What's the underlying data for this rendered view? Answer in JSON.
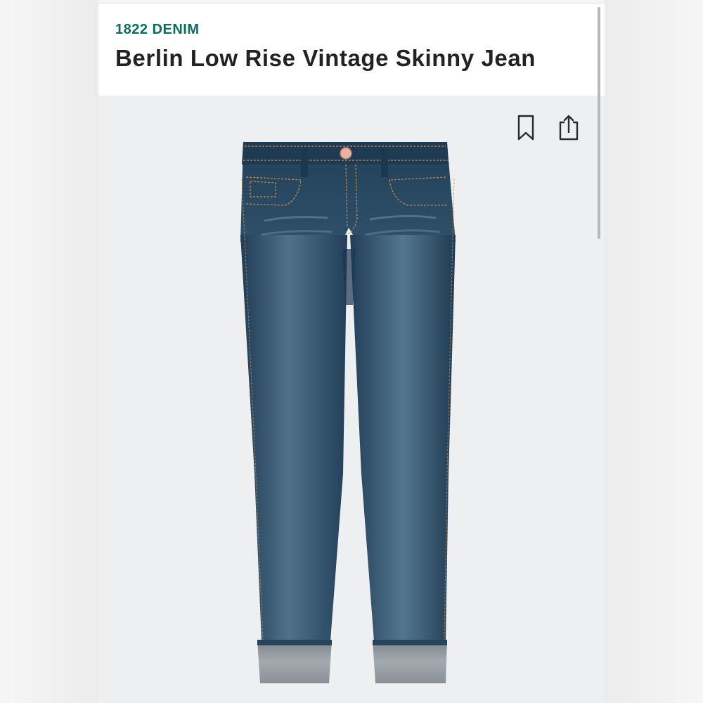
{
  "product": {
    "brand": "1822 DENIM",
    "title": "Berlin Low Rise Vintage Skinny Jean"
  },
  "actions": {
    "bookmark_icon": "bookmark-icon",
    "share_icon": "share-icon"
  },
  "colors": {
    "brand_text": "#0d6b5f",
    "title_text": "#222222",
    "denim_dark": "#26455f",
    "denim_light": "#5f8096",
    "cuff": "#8d949c",
    "stitching": "#c48a4c",
    "background": "#eeeff1"
  }
}
